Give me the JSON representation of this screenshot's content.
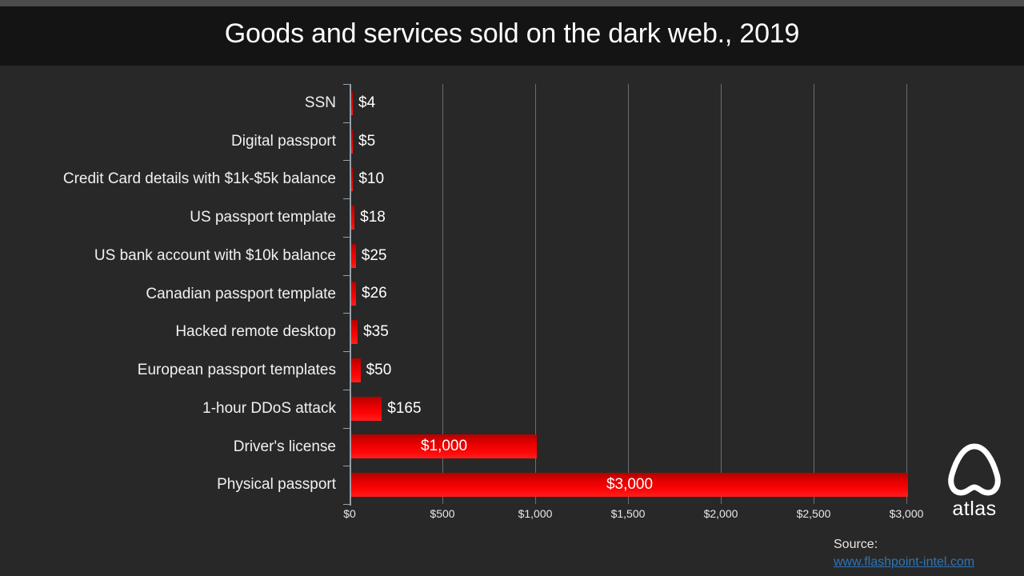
{
  "slide": {
    "background_color": "#282828",
    "title_band_color": "#141414",
    "top_strip_color": "#4d4d4d"
  },
  "header": {
    "title": "Goods and services sold on the dark web., 2019"
  },
  "footer": {
    "source_label": "Source:",
    "source_link": "www.flashpoint-intel.com",
    "link_color": "#2e75b6"
  },
  "logo": {
    "name": "atlas",
    "wordmark": "atlas"
  },
  "chart_data": {
    "type": "bar",
    "orientation": "horizontal",
    "title": "Goods and services sold on the dark web., 2019",
    "xlabel": "",
    "ylabel": "",
    "xlim": [
      0,
      3000
    ],
    "xticks": [
      0,
      500,
      1000,
      1500,
      2000,
      2500,
      3000
    ],
    "xtick_labels": [
      "$0",
      "$500",
      "$1,000",
      "$1,500",
      "$2,000",
      "$2,500",
      "$3,000"
    ],
    "grid": true,
    "grid_axis": "x",
    "legend": false,
    "bar_color": "#ff0000",
    "bar_gradient": [
      "#b50000",
      "#ff2020"
    ],
    "categories": [
      "SSN",
      "Digital passport",
      "Credit Card details with $1k-$5k balance",
      "US passport template",
      "US bank account with $10k balance",
      "Canadian passport template",
      "Hacked remote desktop",
      "European passport templates",
      "1-hour DDoS attack",
      "Driver's license",
      "Physical passport"
    ],
    "values": [
      4,
      5,
      10,
      18,
      25,
      26,
      35,
      50,
      165,
      1000,
      3000
    ],
    "data_labels": [
      "$4",
      "$5",
      "$10",
      "$18",
      "$25",
      "$26",
      "$35",
      "$50",
      "$165",
      "$1,000",
      "$3,000"
    ],
    "label_placement": [
      "outside",
      "outside",
      "outside",
      "outside",
      "outside",
      "outside",
      "outside",
      "outside",
      "outside",
      "inside",
      "inside"
    ]
  }
}
